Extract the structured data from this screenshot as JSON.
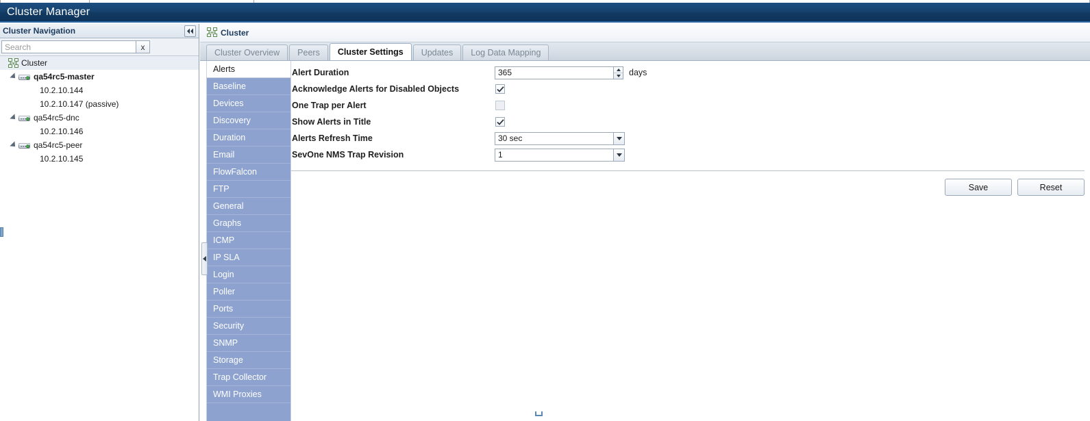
{
  "app": {
    "title": "Cluster Manager"
  },
  "nav": {
    "header_title": "Cluster Navigation",
    "collapse_icon": "chevron-double-left-icon",
    "search": {
      "placeholder": "Search",
      "value": "",
      "clear_label": "x"
    },
    "tree": [
      {
        "label": "Cluster",
        "type": "root",
        "icon": "cluster-icon"
      },
      {
        "label": "qa54rc5-master",
        "type": "host",
        "icon": "server-icon",
        "bold": true
      },
      {
        "label": "10.2.10.144",
        "type": "leaf"
      },
      {
        "label": "10.2.10.147 (passive)",
        "type": "leaf"
      },
      {
        "label": "qa54rc5-dnc",
        "type": "host",
        "icon": "server-icon",
        "bold": false
      },
      {
        "label": "10.2.10.146",
        "type": "leaf"
      },
      {
        "label": "qa54rc5-peer",
        "type": "host",
        "icon": "server-icon",
        "bold": false
      },
      {
        "label": "10.2.10.145",
        "type": "leaf"
      }
    ]
  },
  "page": {
    "breadcrumb": "Cluster",
    "breadcrumb_icon": "cluster-icon"
  },
  "tabs": [
    {
      "label": "Cluster Overview",
      "active": false
    },
    {
      "label": "Peers",
      "active": false
    },
    {
      "label": "Cluster Settings",
      "active": true
    },
    {
      "label": "Updates",
      "active": false
    },
    {
      "label": "Log Data Mapping",
      "active": false
    }
  ],
  "settings_list": [
    {
      "label": "Alerts",
      "active": true
    },
    {
      "label": "Baseline",
      "active": false
    },
    {
      "label": "Devices",
      "active": false
    },
    {
      "label": "Discovery",
      "active": false
    },
    {
      "label": "Duration",
      "active": false
    },
    {
      "label": "Email",
      "active": false
    },
    {
      "label": "FlowFalcon",
      "active": false
    },
    {
      "label": "FTP",
      "active": false
    },
    {
      "label": "General",
      "active": false
    },
    {
      "label": "Graphs",
      "active": false
    },
    {
      "label": "ICMP",
      "active": false
    },
    {
      "label": "IP SLA",
      "active": false
    },
    {
      "label": "Login",
      "active": false
    },
    {
      "label": "Poller",
      "active": false
    },
    {
      "label": "Ports",
      "active": false
    },
    {
      "label": "Security",
      "active": false
    },
    {
      "label": "SNMP",
      "active": false
    },
    {
      "label": "Storage",
      "active": false
    },
    {
      "label": "Trap Collector",
      "active": false
    },
    {
      "label": "WMI Proxies",
      "active": false
    }
  ],
  "form": {
    "alert_duration": {
      "label": "Alert Duration",
      "value": "365",
      "unit": "days"
    },
    "acknowledge_alerts": {
      "label": "Acknowledge Alerts for Disabled Objects",
      "checked": true
    },
    "one_trap_per_alert": {
      "label": "One Trap per Alert",
      "checked": false
    },
    "show_alerts_in_title": {
      "label": "Show Alerts in Title",
      "checked": true
    },
    "alerts_refresh_time": {
      "label": "Alerts Refresh Time",
      "value": "30 sec"
    },
    "trap_revision": {
      "label": "SevOne NMS Trap Revision",
      "value": "1"
    }
  },
  "actions": {
    "save_label": "Save",
    "reset_label": "Reset"
  },
  "colors": {
    "titlebar": "#17436f",
    "settings_list": "#8da2ce",
    "accent_border": "#2e6aa8",
    "status_dot": "#4caf50"
  }
}
